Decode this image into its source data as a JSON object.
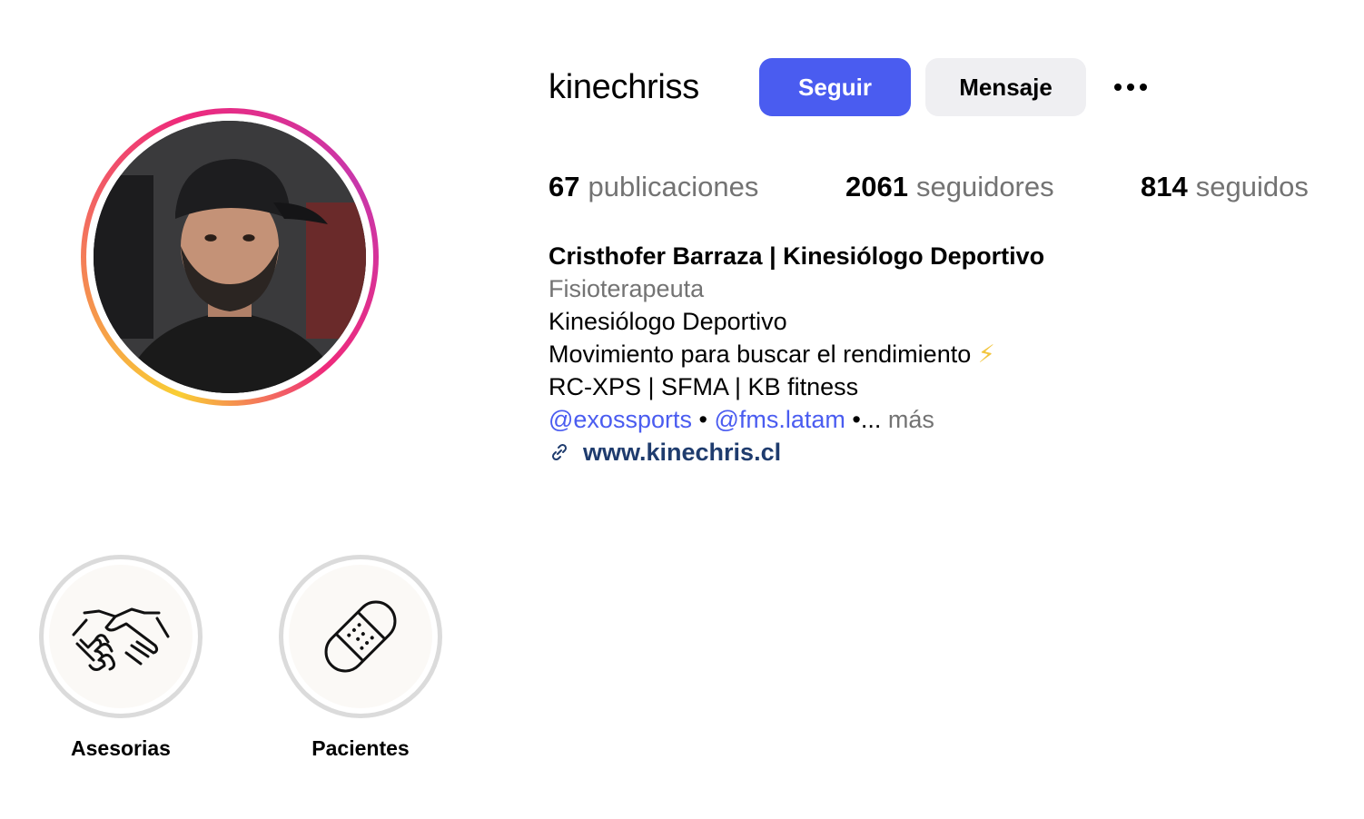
{
  "profile": {
    "username": "kinechriss",
    "avatar_icon": "profile-photo"
  },
  "actions": {
    "follow_label": "Seguir",
    "message_label": "Mensaje",
    "more_icon": "more-options-icon"
  },
  "stats": {
    "posts_count": "67",
    "posts_label": "publicaciones",
    "followers_count": "2061",
    "followers_label": "seguidores",
    "following_count": "814",
    "following_label": "seguidos"
  },
  "bio": {
    "full_name": "Cristhofer Barraza | Kinesiólogo Deportivo",
    "category": "Fisioterapeuta",
    "line1": "Kinesiólogo Deportivo",
    "line2": "Movimiento para buscar el rendimiento",
    "line2_emoji": "⚡",
    "line3": "RC-XPS | SFMA | KB fitness",
    "mention1": "@exossports",
    "separator": "•",
    "mention2": "@fms.latam",
    "ellipsis": "•...",
    "more": "más",
    "website": "www.kinechris.cl"
  },
  "highlights": [
    {
      "label": "Asesorias",
      "icon": "handshake-icon"
    },
    {
      "label": "Pacientes",
      "icon": "bandage-icon"
    }
  ],
  "colors": {
    "accent": "#4a5cf0",
    "secondary_text": "#737373",
    "link": "#1f3c6e",
    "button_bg": "#efeff2"
  }
}
